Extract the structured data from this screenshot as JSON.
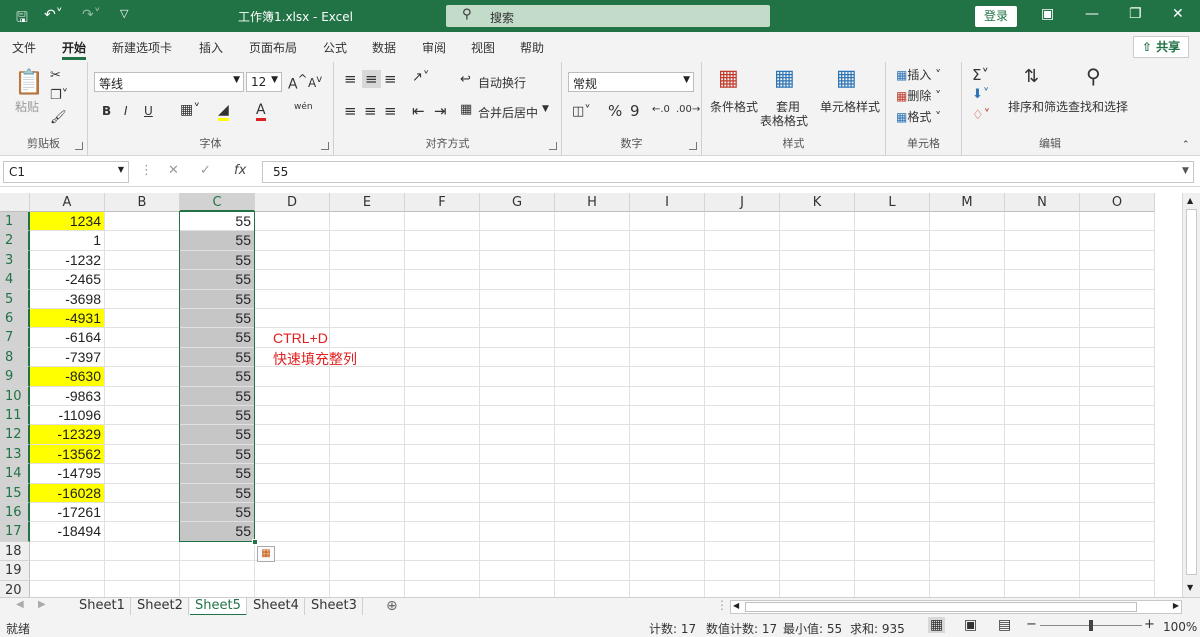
{
  "title": "工作簿1.xlsx  -  Excel",
  "search": {
    "placeholder": "搜索"
  },
  "login": "登录",
  "ribbon_tabs": [
    "文件",
    "开始",
    "新建选项卡",
    "插入",
    "页面布局",
    "公式",
    "数据",
    "审阅",
    "视图",
    "帮助"
  ],
  "share": "共享",
  "ribbon": {
    "clipboard": {
      "paste": "粘贴",
      "label": "剪贴板"
    },
    "font": {
      "name": "等线",
      "size": "12",
      "label": "字体",
      "bold": "B",
      "italic": "I",
      "underline": "U",
      "pinyin": "wén"
    },
    "alignment": {
      "wrap": "自动换行",
      "merge": "合并后居中",
      "label": "对齐方式"
    },
    "number": {
      "format": "常规",
      "label": "数字",
      "percent": "%",
      "comma": "9"
    },
    "styles": {
      "conditional": "条件格式",
      "table1": "套用",
      "table2": "表格格式",
      "cell_styles": "单元格样式",
      "label": "样式"
    },
    "cells": {
      "insert": "插入",
      "delete": "删除",
      "format": "格式",
      "label": "单元格"
    },
    "editing": {
      "sort": "排序和筛选",
      "find": "查找和选择",
      "label": "编辑"
    }
  },
  "formula_bar": {
    "name_box": "C1",
    "value": "55"
  },
  "columns": [
    "A",
    "B",
    "C",
    "D",
    "E",
    "F",
    "G",
    "H",
    "I",
    "J",
    "K",
    "L",
    "M",
    "N",
    "O"
  ],
  "rows": [
    "1",
    "2",
    "3",
    "4",
    "5",
    "6",
    "7",
    "8",
    "9",
    "10",
    "11",
    "12",
    "13",
    "14",
    "15",
    "16",
    "17",
    "18",
    "19",
    "20"
  ],
  "col_a": [
    "1234",
    "1",
    "-1232",
    "-2465",
    "-3698",
    "-4931",
    "-6164",
    "-7397",
    "-8630",
    "-9863",
    "-11096",
    "-12329",
    "-13562",
    "-14795",
    "-16028",
    "-17261",
    "-18494"
  ],
  "col_a_highlight": [
    1,
    0,
    0,
    0,
    0,
    1,
    0,
    0,
    1,
    0,
    0,
    1,
    1,
    0,
    1,
    0,
    0
  ],
  "col_c": [
    "55",
    "55",
    "55",
    "55",
    "55",
    "55",
    "55",
    "55",
    "55",
    "55",
    "55",
    "55",
    "55",
    "55",
    "55",
    "55",
    "55"
  ],
  "note": {
    "line1": "CTRL+D",
    "line2": "快速填充整列"
  },
  "sheets": [
    "Sheet1",
    "Sheet2",
    "Sheet5",
    "Sheet4",
    "Sheet3"
  ],
  "active_sheet": "Sheet5",
  "status": {
    "ready": "就绪",
    "count": "计数: 17",
    "numcount": "数值计数: 17",
    "min": "最小值: 55",
    "sum": "求和: 935",
    "zoom": "100%"
  },
  "colors": {
    "accent": "#217346",
    "highlight": "#ffff00",
    "note": "#e02020"
  }
}
